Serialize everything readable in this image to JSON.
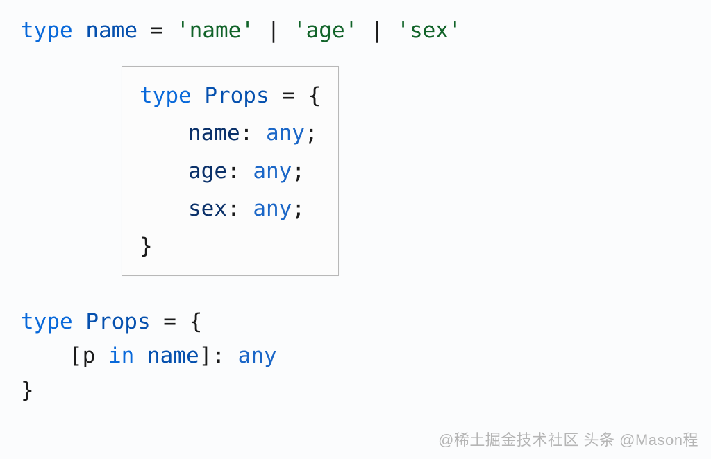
{
  "line1": {
    "kw": "type",
    "name": "name",
    "eq": " = ",
    "s1": "'name'",
    "pipe": " | ",
    "s2": "'age'",
    "s3": "'sex'"
  },
  "tooltip": {
    "l1_kw": "type",
    "l1_name": " Props",
    "l1_eq": " = {",
    "l2_prop": "name",
    "l2_colon": ": ",
    "l2_type": "any",
    "l2_semi": ";",
    "l3_prop": "age",
    "l3_colon": ": ",
    "l3_type": "any",
    "l3_semi": ";",
    "l4_prop": "sex",
    "l4_colon": ": ",
    "l4_type": "any",
    "l4_semi": ";",
    "l5": "}"
  },
  "bottom": {
    "l1_kw": "type",
    "l1_name": " Props",
    "l1_eq": " = {",
    "l2_open": "[",
    "l2_p": "p",
    "l2_in": " in ",
    "l2_name": "name",
    "l2_close": "]: ",
    "l2_type": "any",
    "l3": "}"
  },
  "watermark": "@稀土掘金技术社区 头条 @Mason程"
}
